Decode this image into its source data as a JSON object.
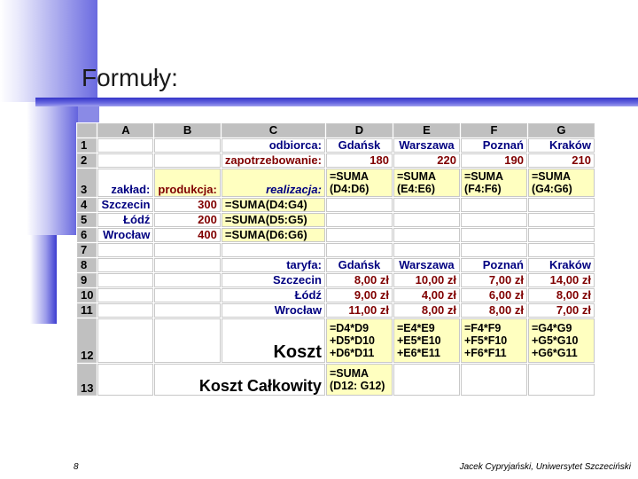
{
  "slide": {
    "title": "Formuły:",
    "page_number": "8",
    "footer": "Jacek Cypryjański, Uniwersytet Szczeciński"
  },
  "sheet": {
    "columns": [
      "A",
      "B",
      "C",
      "D",
      "E",
      "F",
      "G"
    ],
    "rows": [
      "1",
      "2",
      "3",
      "4",
      "5",
      "6",
      "7",
      "8",
      "9",
      "10",
      "11",
      "12",
      "13"
    ],
    "r1": {
      "C": "odbiorca:",
      "D": "Gdańsk",
      "E": "Warszawa",
      "F": "Poznań",
      "G": "Kraków"
    },
    "r2": {
      "C": "zapotrzebowanie:",
      "D": "180",
      "E": "220",
      "F": "190",
      "G": "210"
    },
    "r3": {
      "A": "zakład:",
      "B": "produkcja:",
      "C": "realizacja:",
      "D": "=SUMA\n(D4:D6)",
      "E": "=SUMA\n(E4:E6)",
      "F": "=SUMA\n(F4:F6)",
      "G": "=SUMA\n(G4:G6)"
    },
    "r4": {
      "A": "Szczecin",
      "B": "300",
      "C": "=SUMA(D4:G4)"
    },
    "r5": {
      "A": "Łódź",
      "B": "200",
      "C": "=SUMA(D5:G5)"
    },
    "r6": {
      "A": "Wrocław",
      "B": "400",
      "C": "=SUMA(D6:G6)"
    },
    "r8": {
      "C": "taryfa:",
      "D": "Gdańsk",
      "E": "Warszawa",
      "F": "Poznań",
      "G": "Kraków"
    },
    "r9": {
      "C": "Szczecin",
      "D": "8,00 zł",
      "E": "10,00 zł",
      "F": "7,00 zł",
      "G": "14,00 zł"
    },
    "r10": {
      "C": "Łódź",
      "D": "9,00 zł",
      "E": "4,00 zł",
      "F": "6,00 zł",
      "G": "8,00 zł"
    },
    "r11": {
      "C": "Wrocław",
      "D": "11,00 zł",
      "E": "8,00 zł",
      "F": "8,00 zł",
      "G": "7,00 zł"
    },
    "r12": {
      "C": "Koszt",
      "D": "=D4*D9\n+D5*D10\n+D6*D11",
      "E": "=E4*E9\n+E5*E10\n+E6*E11",
      "F": "=F4*F9\n+F5*F10\n+F6*F11",
      "G": "=G4*G9\n+G5*G10\n+G6*G11"
    },
    "r13": {
      "BC": "Koszt Całkowity",
      "D": "=SUMA\n(D12: G12)"
    }
  }
}
